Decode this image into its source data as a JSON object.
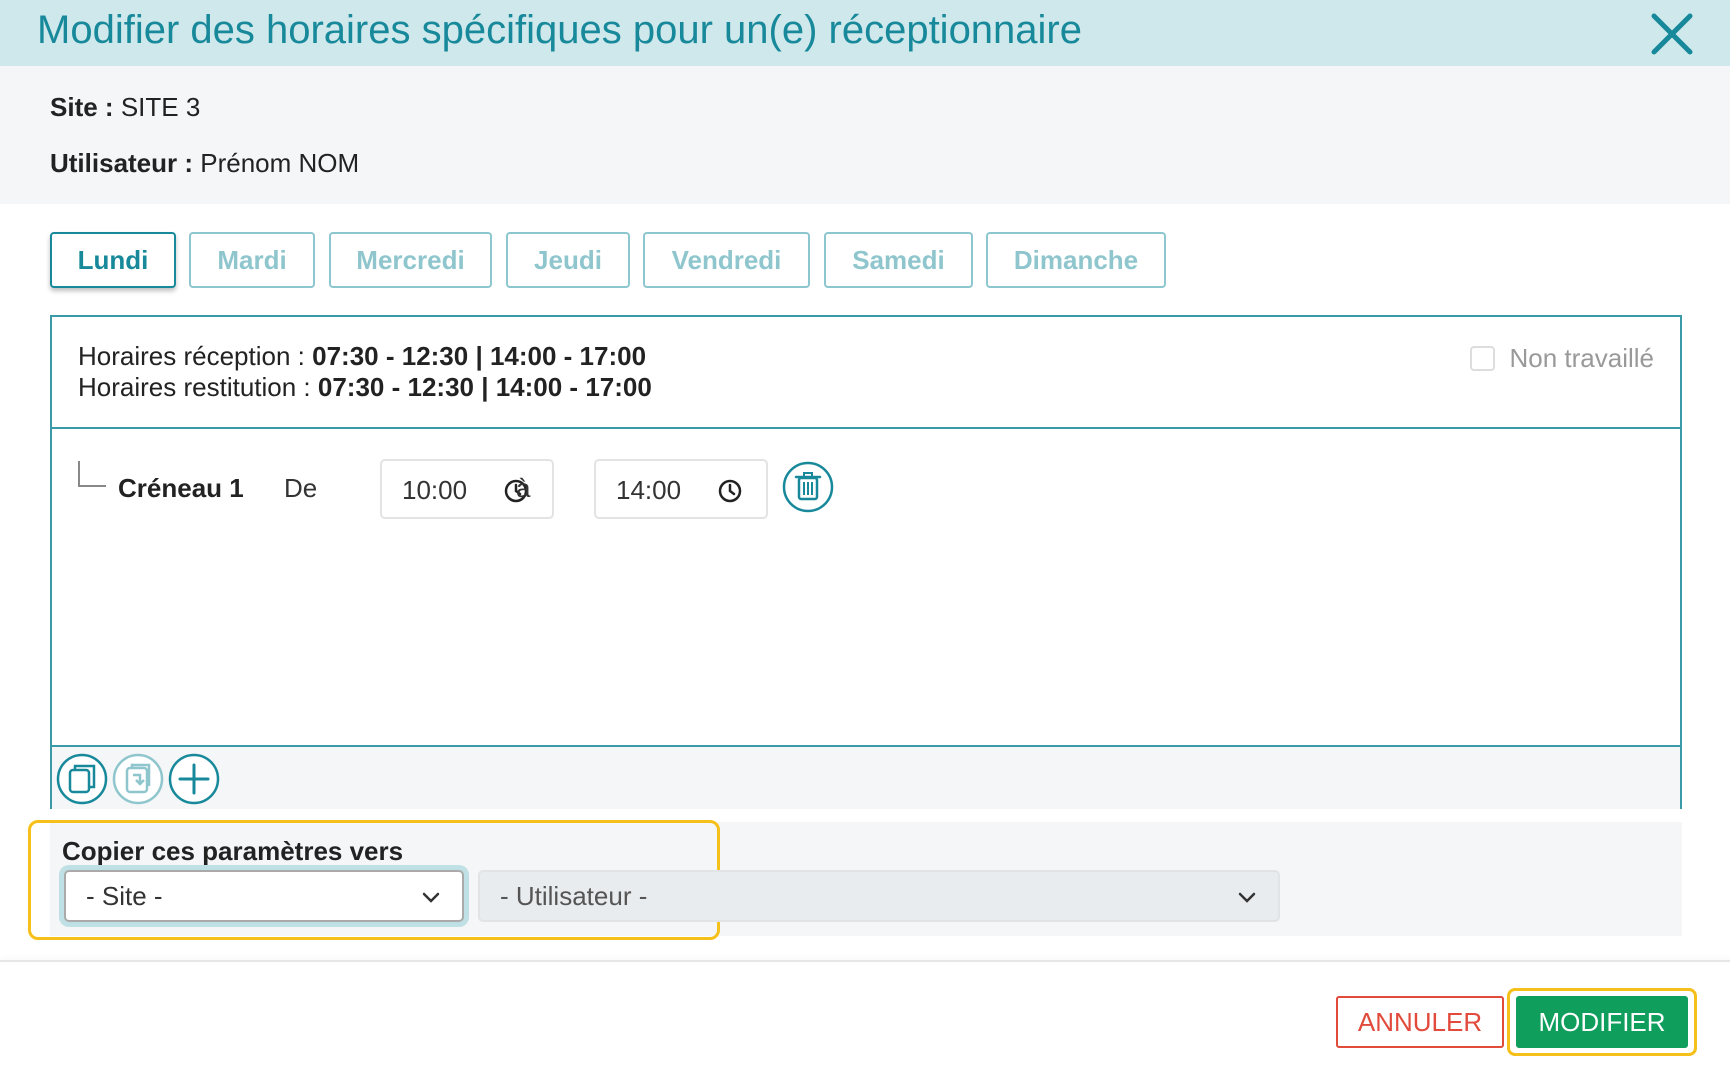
{
  "dialog": {
    "title": "Modifier des horaires spécifiques pour un(e) réceptionnaire"
  },
  "info": {
    "site_label": "Site :",
    "site_value": "SITE 3",
    "user_label": "Utilisateur :",
    "user_value": "Prénom NOM"
  },
  "tabs": [
    {
      "label": "Lundi",
      "active": true
    },
    {
      "label": "Mardi",
      "active": false
    },
    {
      "label": "Mercredi",
      "active": false
    },
    {
      "label": "Jeudi",
      "active": false
    },
    {
      "label": "Vendredi",
      "active": false
    },
    {
      "label": "Samedi",
      "active": false
    },
    {
      "label": "Dimanche",
      "active": false
    }
  ],
  "schedule": {
    "reception_label": "Horaires réception :",
    "reception_value": "07:30 - 12:30 | 14:00 - 17:00",
    "restitution_label": "Horaires restitution :",
    "restitution_value": "07:30 - 12:30 | 14:00 - 17:00",
    "non_worked_label": "Non travaillé",
    "non_worked_checked": false
  },
  "slots": [
    {
      "label": "Créneau 1",
      "from_label": "De",
      "from_value": "10:00",
      "to_label": "à",
      "to_value": "14:00"
    }
  ],
  "toolbar": {
    "icons": [
      "copy-icon",
      "paste-icon",
      "add-icon"
    ]
  },
  "copy": {
    "label": "Copier ces paramètres vers",
    "site_select": "- Site -",
    "user_select": "- Utilisateur -"
  },
  "footer": {
    "cancel_label": "ANNULER",
    "submit_label": "MODIFIER"
  },
  "colors": {
    "primary": "#17899a",
    "header_bg": "#cfe8ec",
    "cancel": "#e24b3b",
    "submit": "#0f9e5c",
    "highlight": "#f5c01a"
  }
}
